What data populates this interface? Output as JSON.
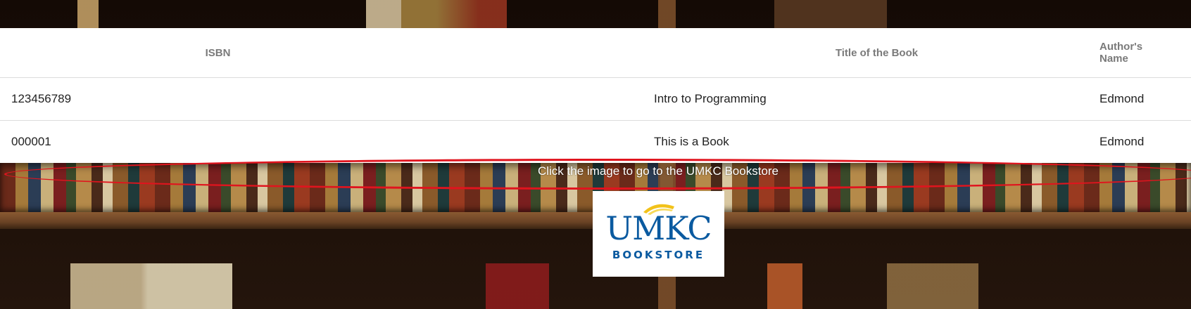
{
  "table": {
    "headers": {
      "isbn": "ISBN",
      "title": "Title of the Book",
      "author": "Author's Name"
    },
    "rows": [
      {
        "isbn": "123456789",
        "title": "Intro to Programming",
        "author": "Edmond"
      },
      {
        "isbn": "000001",
        "title": "This is a Book",
        "author": "Edmond"
      }
    ]
  },
  "caption": "Click the image to go to the UMKC Bookstore",
  "logo": {
    "main": "UMKC",
    "sub": "BOOKSTORE",
    "icon": "bookstore-logo-swoosh-icon"
  },
  "colors": {
    "logo_blue": "#0a5aa0",
    "logo_gold": "#f2c21a",
    "annotation_red": "#e0141e"
  }
}
